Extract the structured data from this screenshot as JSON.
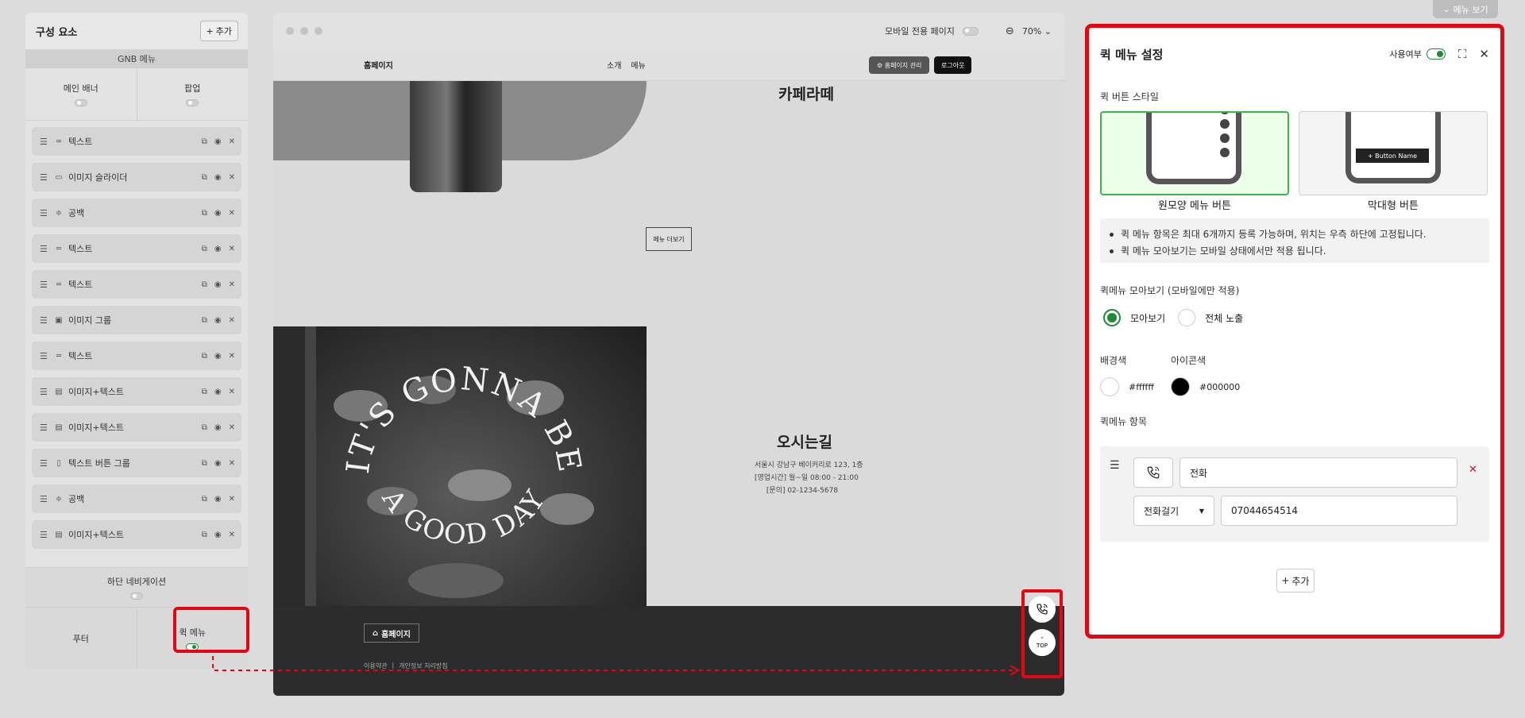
{
  "top": {
    "menu_view_label": "메뉴 보기"
  },
  "left_panel": {
    "title": "구성 요소",
    "add_label": "추가",
    "gnb_label": "GNB 메뉴",
    "toggles": [
      {
        "label": "메인 배너",
        "on": false
      },
      {
        "label": "팝업",
        "on": false
      }
    ],
    "components": [
      {
        "label": "텍스트",
        "kind_icon": "text-lines-icon"
      },
      {
        "label": "이미지 슬라이더",
        "kind_icon": "slider-icon"
      },
      {
        "label": "공백",
        "kind_icon": "spacer-icon"
      },
      {
        "label": "텍스트",
        "kind_icon": "text-lines-icon"
      },
      {
        "label": "텍스트",
        "kind_icon": "text-lines-icon"
      },
      {
        "label": "이미지 그룹",
        "kind_icon": "image-group-icon"
      },
      {
        "label": "텍스트",
        "kind_icon": "text-lines-icon"
      },
      {
        "label": "이미지+텍스트",
        "kind_icon": "image-text-icon"
      },
      {
        "label": "이미지+텍스트",
        "kind_icon": "image-text-icon"
      },
      {
        "label": "텍스트 버튼 그룹",
        "kind_icon": "button-group-icon"
      },
      {
        "label": "공백",
        "kind_icon": "spacer-icon"
      },
      {
        "label": "이미지+텍스트",
        "kind_icon": "image-text-icon"
      }
    ],
    "bottom_nav_label": "하단 네비게이션",
    "footer_label": "푸터",
    "quick_menu_label": "퀵 메뉴"
  },
  "preview": {
    "mobile_only_label": "모바일 전용 페이지",
    "zoom": "70%",
    "nav": {
      "brand": "홈페이지",
      "links": [
        "소개",
        "메뉴"
      ],
      "admin_button": "⚙ 홈페이지 관리",
      "logout_button": "로그아웃"
    },
    "cafe_latte_title": "카페라떼",
    "more_button": "메뉴 더보기",
    "photo_text_top": "IT'S GONNA BE",
    "photo_text_bottom": "A GOOD DAY",
    "directions_title": "오시는길",
    "address": "서울시 강남구 베이커리로 123, 1층",
    "hours": "[영업시간] 월~일 08:00 - 21:00",
    "contact": "[문의] 02-1234-5678",
    "footer_brand": "홈페이지",
    "footer_links": [
      "이용약관",
      "|",
      "개인정보 처리방침"
    ],
    "top_button_label": "TOP"
  },
  "right_panel": {
    "title": "퀵 메뉴 설정",
    "use_label": "사용여부",
    "use_on": true,
    "button_style_label": "퀵 버튼 스타일",
    "styles": [
      {
        "caption": "원모양 메뉴 버튼",
        "selected": true
      },
      {
        "caption": "막대형 버튼",
        "selected": false,
        "sample_text": "+ Button Name"
      }
    ],
    "notes": [
      "퀵 메뉴 항목은 최대 6개까지 등록 가능하며, 위치는 우측 하단에 고정됩니다.",
      "퀵 메뉴 모아보기는 모바일 상태에서만 적용 됩니다."
    ],
    "collect_label": "퀵메뉴 모아보기 (모바일에만 적용)",
    "radio_options": [
      {
        "label": "모아보기",
        "checked": true
      },
      {
        "label": "전체 노출",
        "checked": false
      }
    ],
    "bg_color_label": "배경색",
    "bg_color": "#ffffff",
    "bg_color_text": "#ffffff",
    "icon_color_label": "아이콘색",
    "icon_color": "#000000",
    "icon_color_text": "#000000",
    "items_label": "퀵메뉴 항목",
    "item": {
      "icon": "phone-icon",
      "name": "전화",
      "action": "전화걸기",
      "value": "07044654514"
    },
    "add_label": "추가"
  },
  "colors": {
    "accent_green": "#1f8a3b",
    "highlight_red": "#e30613"
  }
}
